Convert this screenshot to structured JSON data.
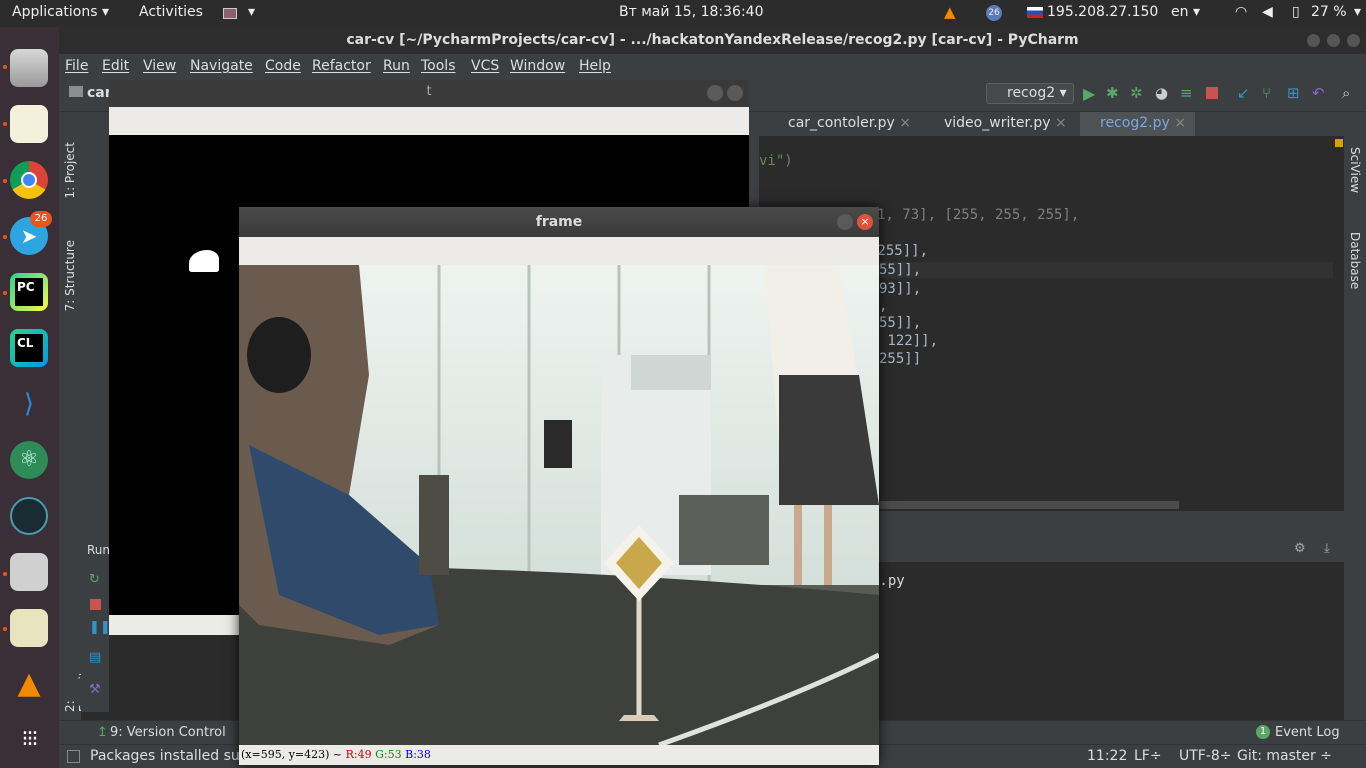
{
  "topbar": {
    "applications": "Applications",
    "activities": "Activities",
    "clock": "Вт май 15, 18:36:40",
    "badge_count": "26",
    "ip": "195.208.27.150",
    "lang": "en",
    "battery": "27 %"
  },
  "dock": {
    "telegram_badge": "26",
    "pycharm_label": "PC",
    "clion_label": "CL"
  },
  "ide": {
    "title": "car-cv [~/PycharmProjects/car-cv] - .../hackatonYandexRelease/recog2.py [car-cv] - PyCharm",
    "menu": [
      "File",
      "Edit",
      "View",
      "Navigate",
      "Code",
      "Refactor",
      "Run",
      "Tools",
      "VCS",
      "Window",
      "Help"
    ],
    "breadcrumb": "car",
    "run_config": "recog2",
    "tabs": [
      "car_contoler.py",
      "video_writer.py",
      "recog2.py"
    ],
    "left_tools": [
      "1: Project",
      "7: Structure",
      "2: Favorites"
    ],
    "right_tools": [
      "SciView",
      "Database"
    ],
    "code_lines": [
      "vi\")",
      ",  # [[119, 101, 73], [255, 255, 255],",
      " 255]],",
      "55]],",
      "93]],",
      ",",
      "55]],",
      " 122]],",
      "255]]"
    ],
    "run_label": "Run",
    "run_output": "2.py",
    "version_control": "9: Version Control",
    "event_log": "Event Log",
    "status_message": "Packages installed suc",
    "position": "11:22",
    "line_sep": "LF÷",
    "encoding": "UTF-8÷",
    "git_branch": "Git: master ÷"
  },
  "mask_window": {
    "title": "t"
  },
  "frame_window": {
    "title": "frame",
    "status_coords": "(x=595, y=423) ~ ",
    "status_r": "R:49",
    "status_g": "G:53",
    "status_b": "B:38"
  },
  "colors": {
    "accent": "#e95420",
    "run_green": "#59a869",
    "stop_red": "#c75450",
    "link_blue": "#7aa9e0"
  }
}
